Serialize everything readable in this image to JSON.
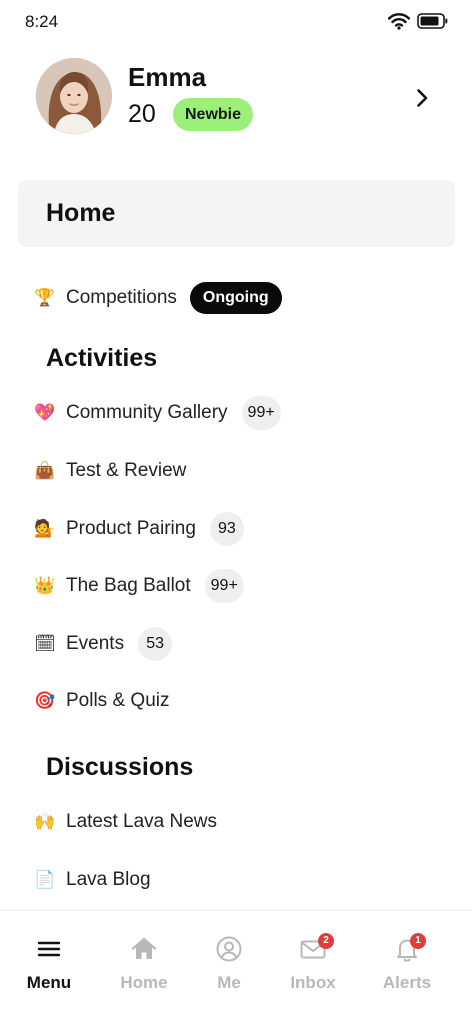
{
  "status": {
    "time": "8:24"
  },
  "profile": {
    "name": "Emma",
    "age": "20",
    "level": "Newbie"
  },
  "home_card": {
    "title": "Home"
  },
  "competitions": {
    "emoji": "🏆",
    "label": "Competitions",
    "status": "Ongoing"
  },
  "activities": {
    "title": "Activities",
    "items": [
      {
        "emoji": "💖",
        "label": "Community Gallery",
        "count": "99+"
      },
      {
        "emoji": "👜",
        "label": "Test & Review",
        "count": ""
      },
      {
        "emoji": "💁",
        "label": "Product Pairing",
        "count": "93"
      },
      {
        "emoji": "👑",
        "label": "The Bag Ballot",
        "count": "99+"
      },
      {
        "emoji": "🗓",
        "label": "Events",
        "count": "53"
      },
      {
        "emoji": "🎯",
        "label": "Polls & Quiz",
        "count": ""
      }
    ]
  },
  "discussions": {
    "title": "Discussions",
    "items": [
      {
        "emoji": "🙌",
        "label": "Latest Lava News"
      },
      {
        "emoji": "📄",
        "label": "Lava Blog"
      }
    ]
  },
  "bottom_nav": {
    "menu": "Menu",
    "home": "Home",
    "me": "Me",
    "inbox": "Inbox",
    "inbox_badge": "2",
    "alerts": "Alerts",
    "alerts_badge": "1"
  },
  "colors": {
    "level_badge": "#9af07a",
    "ongoing_badge": "#0a0a0a",
    "notification_badge": "#e23b3b",
    "inactive_nav": "#b8b8b8"
  }
}
